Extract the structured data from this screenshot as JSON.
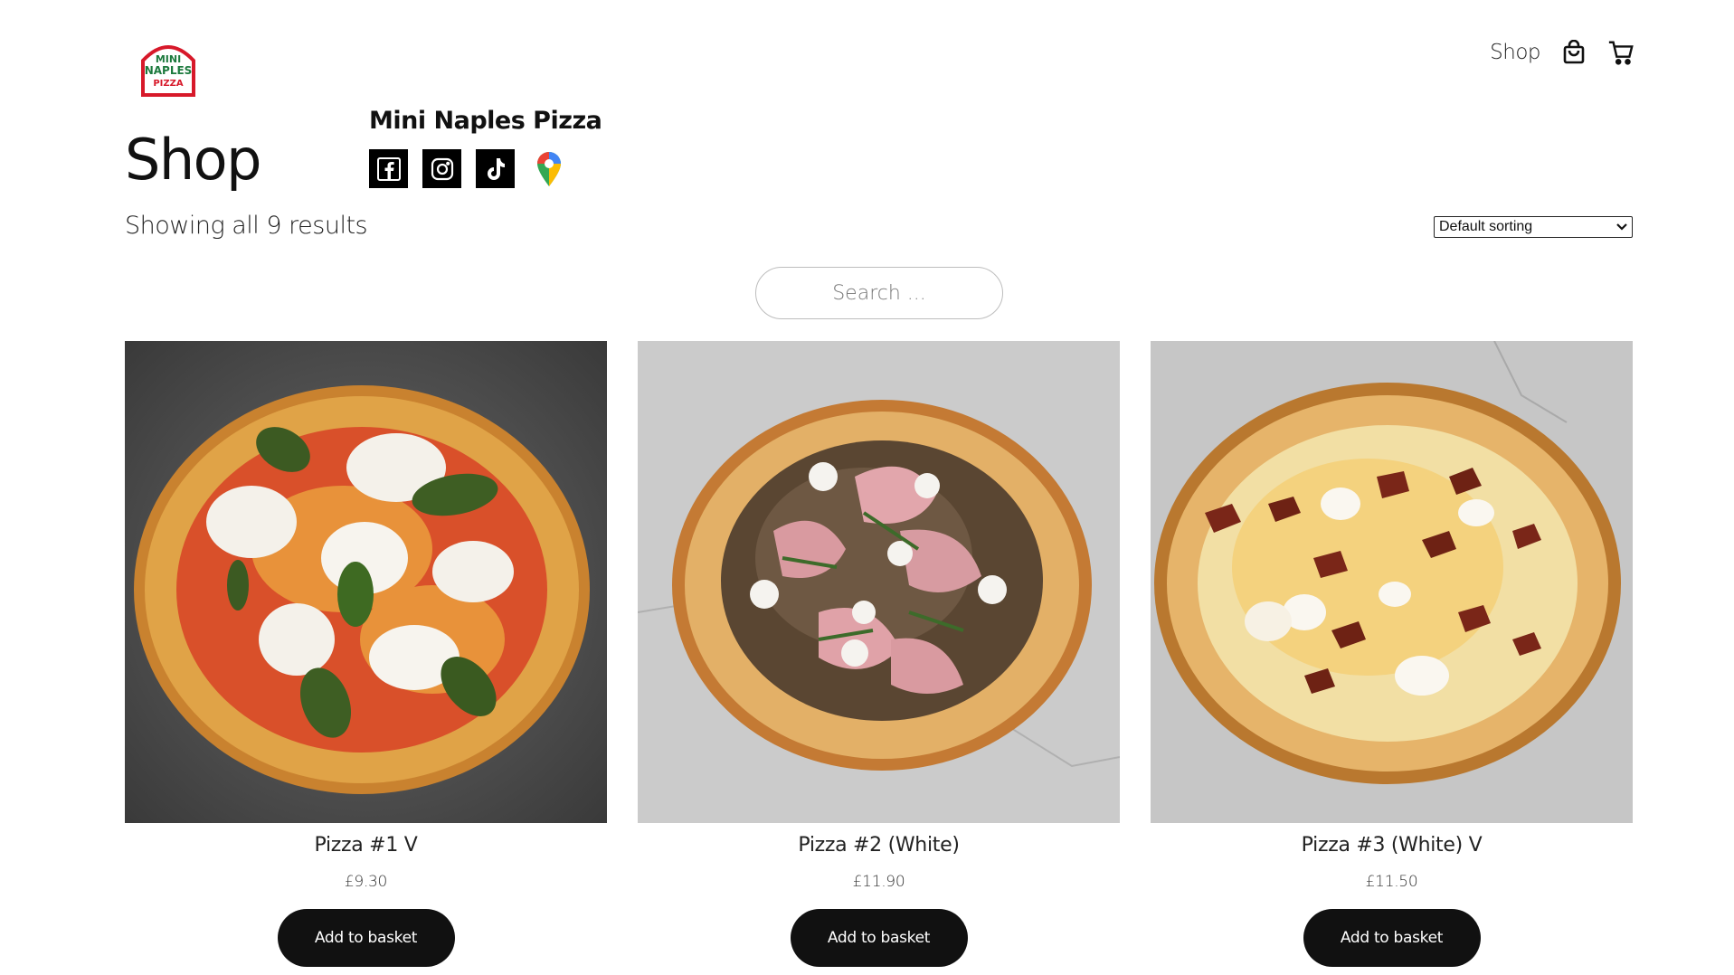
{
  "brand": {
    "logo_text": [
      "MINI",
      "NAPLES",
      "PIZZA"
    ],
    "name": "Mini Naples Pizza",
    "colors": {
      "red": "#d7192a",
      "green": "#1d7a3e"
    }
  },
  "topnav": {
    "shop_label": "Shop",
    "icons": [
      "shopping-bag-icon",
      "cart-icon"
    ]
  },
  "page": {
    "title": "Shop",
    "results_text": "Showing all 9 results",
    "sorting_selected": "Default sorting",
    "search_placeholder": "Search ..."
  },
  "socials": [
    "facebook-icon",
    "instagram-icon",
    "tiktok-icon",
    "google-maps-icon"
  ],
  "products": [
    {
      "name": "Pizza #1 V",
      "price": "£9.30",
      "button": "Add to basket",
      "background": "#4f4f4f"
    },
    {
      "name": "Pizza #2 (White)",
      "price": "£11.90",
      "button": "Add to basket",
      "background": "#c9c9c9"
    },
    {
      "name": "Pizza #3 (White) V",
      "price": "£11.50",
      "button": "Add to basket",
      "background": "#c4c4c4"
    }
  ]
}
